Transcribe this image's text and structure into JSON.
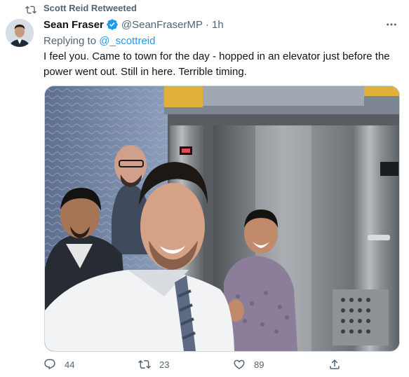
{
  "retweet": {
    "label": "Scott Reid Retweeted",
    "icon": "retweet-icon"
  },
  "author": {
    "name": "Sean Fraser",
    "handle": "@SeanFraserMP",
    "separator": "·",
    "time": "1h",
    "verified": true
  },
  "reply": {
    "prefix": "Replying to ",
    "mention": "@_scottreid"
  },
  "tweet": {
    "line1": "I feel you. Came to town for the day - hopped in an elevator just before the",
    "line2": "power went out. Still in here. Terrible timing."
  },
  "actions": {
    "reply_count": "44",
    "retweet_count": "23",
    "like_count": "89"
  },
  "colors": {
    "accent": "#1d9bf0",
    "muted": "#536471",
    "text": "#0f1419"
  }
}
